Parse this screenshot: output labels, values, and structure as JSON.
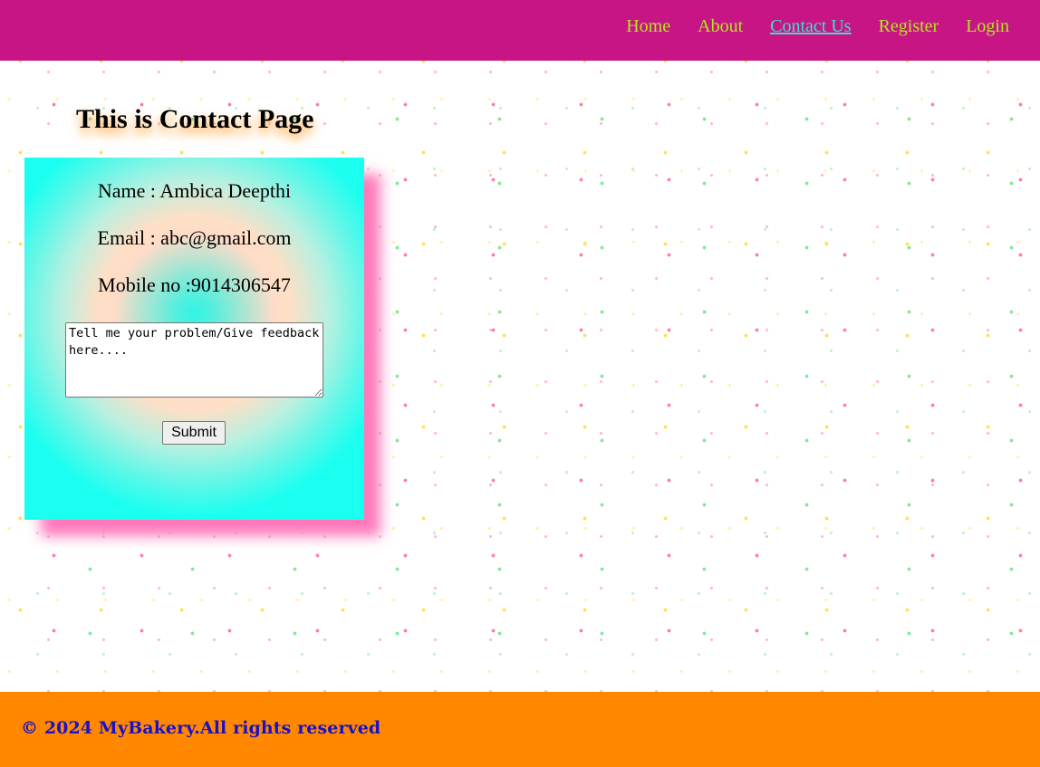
{
  "nav": {
    "items": [
      {
        "label": "Home",
        "active": false
      },
      {
        "label": "About",
        "active": false
      },
      {
        "label": "Contact Us",
        "active": true
      },
      {
        "label": "Register",
        "active": false
      },
      {
        "label": "Login",
        "active": false
      }
    ]
  },
  "colors": {
    "navbar_bg": "#c71585",
    "nav_link": "#b5e61d",
    "nav_link_active": "#40e0d0",
    "footer_bg": "#ff8800",
    "footer_text": "#1a10c8",
    "card_shadow": "#ff69b4"
  },
  "page": {
    "title": "This is Contact Page"
  },
  "contact": {
    "name": "Name : Ambica Deepthi",
    "email": "Email : abc@gmail.com",
    "mobile": "Mobile no :9014306547",
    "feedback_text": "Tell me your problem/Give feedback here....",
    "submit_label": "Submit"
  },
  "footer": {
    "text": "© 2024 MyBakery.All rights reserved"
  }
}
